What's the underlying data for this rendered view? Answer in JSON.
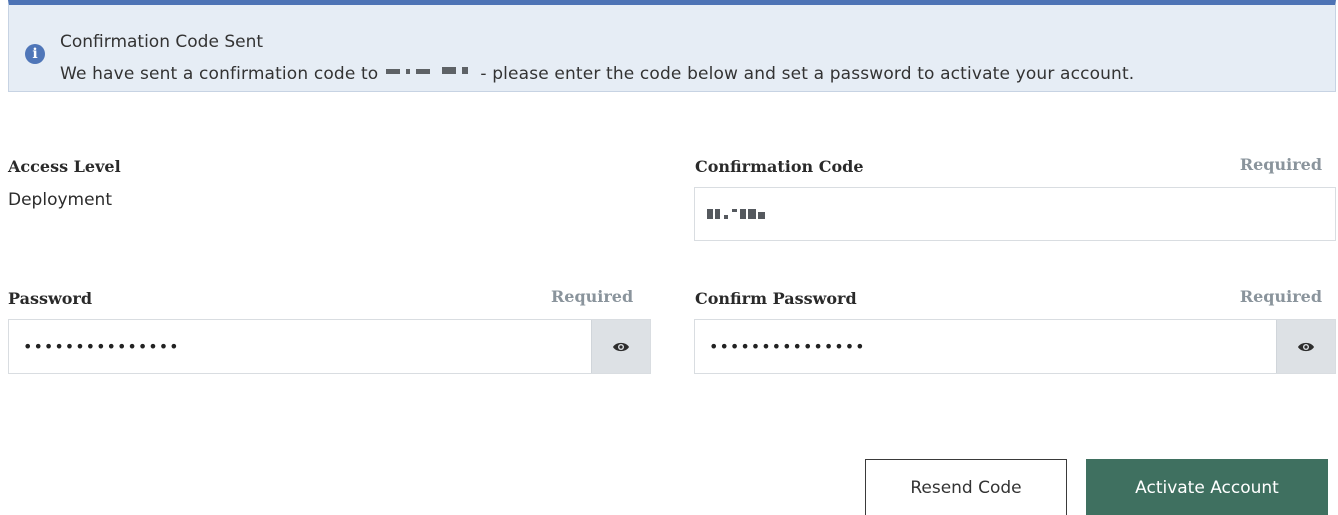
{
  "alert": {
    "title": "Confirmation Code Sent",
    "body_prefix": "We have sent a confirmation code to",
    "body_suffix": "- please enter the code below and set a password to activate your account.",
    "icon": "info-icon"
  },
  "form": {
    "access_level": {
      "label": "Access Level",
      "value": "Deployment"
    },
    "confirmation_code": {
      "label": "Confirmation Code",
      "required_label": "Required"
    },
    "password": {
      "label": "Password",
      "required_label": "Required",
      "value": "•••••••••••••••",
      "toggle_icon": "eye-icon"
    },
    "confirm_password": {
      "label": "Confirm Password",
      "required_label": "Required",
      "value": "•••••••••••••••",
      "toggle_icon": "eye-icon"
    }
  },
  "actions": {
    "resend_label": "Resend Code",
    "activate_label": "Activate Account"
  },
  "colors": {
    "alert_bg": "#e6edf5",
    "alert_border": "#4d73b5",
    "primary_button": "#3f7060",
    "required_text": "#8a949c"
  }
}
